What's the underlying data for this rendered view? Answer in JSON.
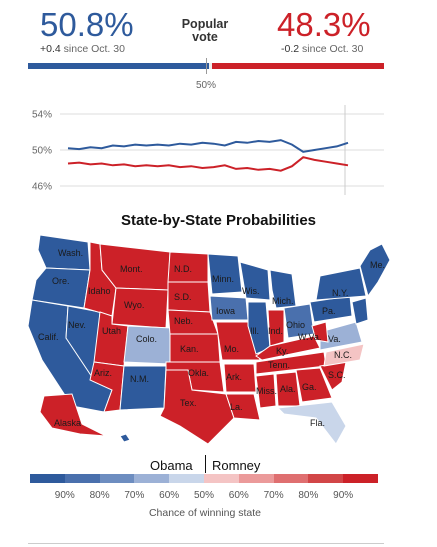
{
  "popular_vote": {
    "label_line1": "Popular",
    "label_line2": "vote",
    "obama_pct": "50.8%",
    "obama_change": "+0.4",
    "obama_since": "since Oct. 30",
    "romney_pct": "48.3%",
    "romney_change": "-0.2",
    "romney_since": "since Oct. 30",
    "midpoint_label": "50%",
    "obama_share": 50.8,
    "romney_share": 48.3,
    "colors": {
      "obama": "#2e5a9c",
      "romney": "#cc2128"
    }
  },
  "chart_data": {
    "type": "line",
    "ylim": [
      45,
      55
    ],
    "y_ticks": [
      "54%",
      "50%",
      "46%"
    ],
    "series": [
      {
        "values": [
          50.2,
          50.1,
          50.3,
          50.2,
          50.5,
          50.4,
          50.6,
          50.5,
          50.6,
          50.5,
          50.7,
          50.6,
          50.8,
          50.7,
          50.5,
          50.9,
          50.8,
          51.0,
          50.9,
          51.1,
          50.6,
          49.8,
          50.0,
          50.2,
          50.4,
          50.8
        ],
        "color": "#2e5a9c"
      },
      {
        "values": [
          48.5,
          48.6,
          48.4,
          48.5,
          48.3,
          48.4,
          48.2,
          48.3,
          48.2,
          48.3,
          48.1,
          48.2,
          48.0,
          48.1,
          48.3,
          47.9,
          48.0,
          47.8,
          47.9,
          47.7,
          48.2,
          49.2,
          48.9,
          48.7,
          48.5,
          48.3
        ],
        "color": "#cc2128"
      }
    ]
  },
  "map": {
    "title": "State-by-State Probabilities",
    "state_labels": [
      "Wash.",
      "Ore.",
      "Idaho",
      "Mont.",
      "N.D.",
      "Minn.",
      "Wis.",
      "Mich.",
      "Me.",
      "N.Y.",
      "Pa.",
      "Ohio",
      "Ind.",
      "Ill.",
      "Iowa",
      "S.D.",
      "Wyo.",
      "Neb.",
      "Nev.",
      "Utah",
      "Colo.",
      "Calif.",
      "Kan.",
      "Mo.",
      "Ky.",
      "W.Va.",
      "Va.",
      "N.C.",
      "Tenn.",
      "Okla.",
      "Ark.",
      "Ariz.",
      "N.M.",
      "Miss.",
      "Ala.",
      "Ga.",
      "S.C.",
      "Tex.",
      "La.",
      "Fla.",
      "Alaska"
    ]
  },
  "legend": {
    "obama_label": "Obama",
    "romney_label": "Romney",
    "ticks": [
      "90%",
      "80%",
      "70%",
      "60%",
      "50%",
      "60%",
      "70%",
      "80%",
      "90%"
    ],
    "caption": "Chance of winning state",
    "colors": [
      "#2e5a9c",
      "#4a70ad",
      "#6d8dc0",
      "#9cb1d6",
      "#c9d6ea",
      "#f4c4c4",
      "#eb9a9a",
      "#df6f70",
      "#d24647",
      "#cc2128"
    ]
  }
}
